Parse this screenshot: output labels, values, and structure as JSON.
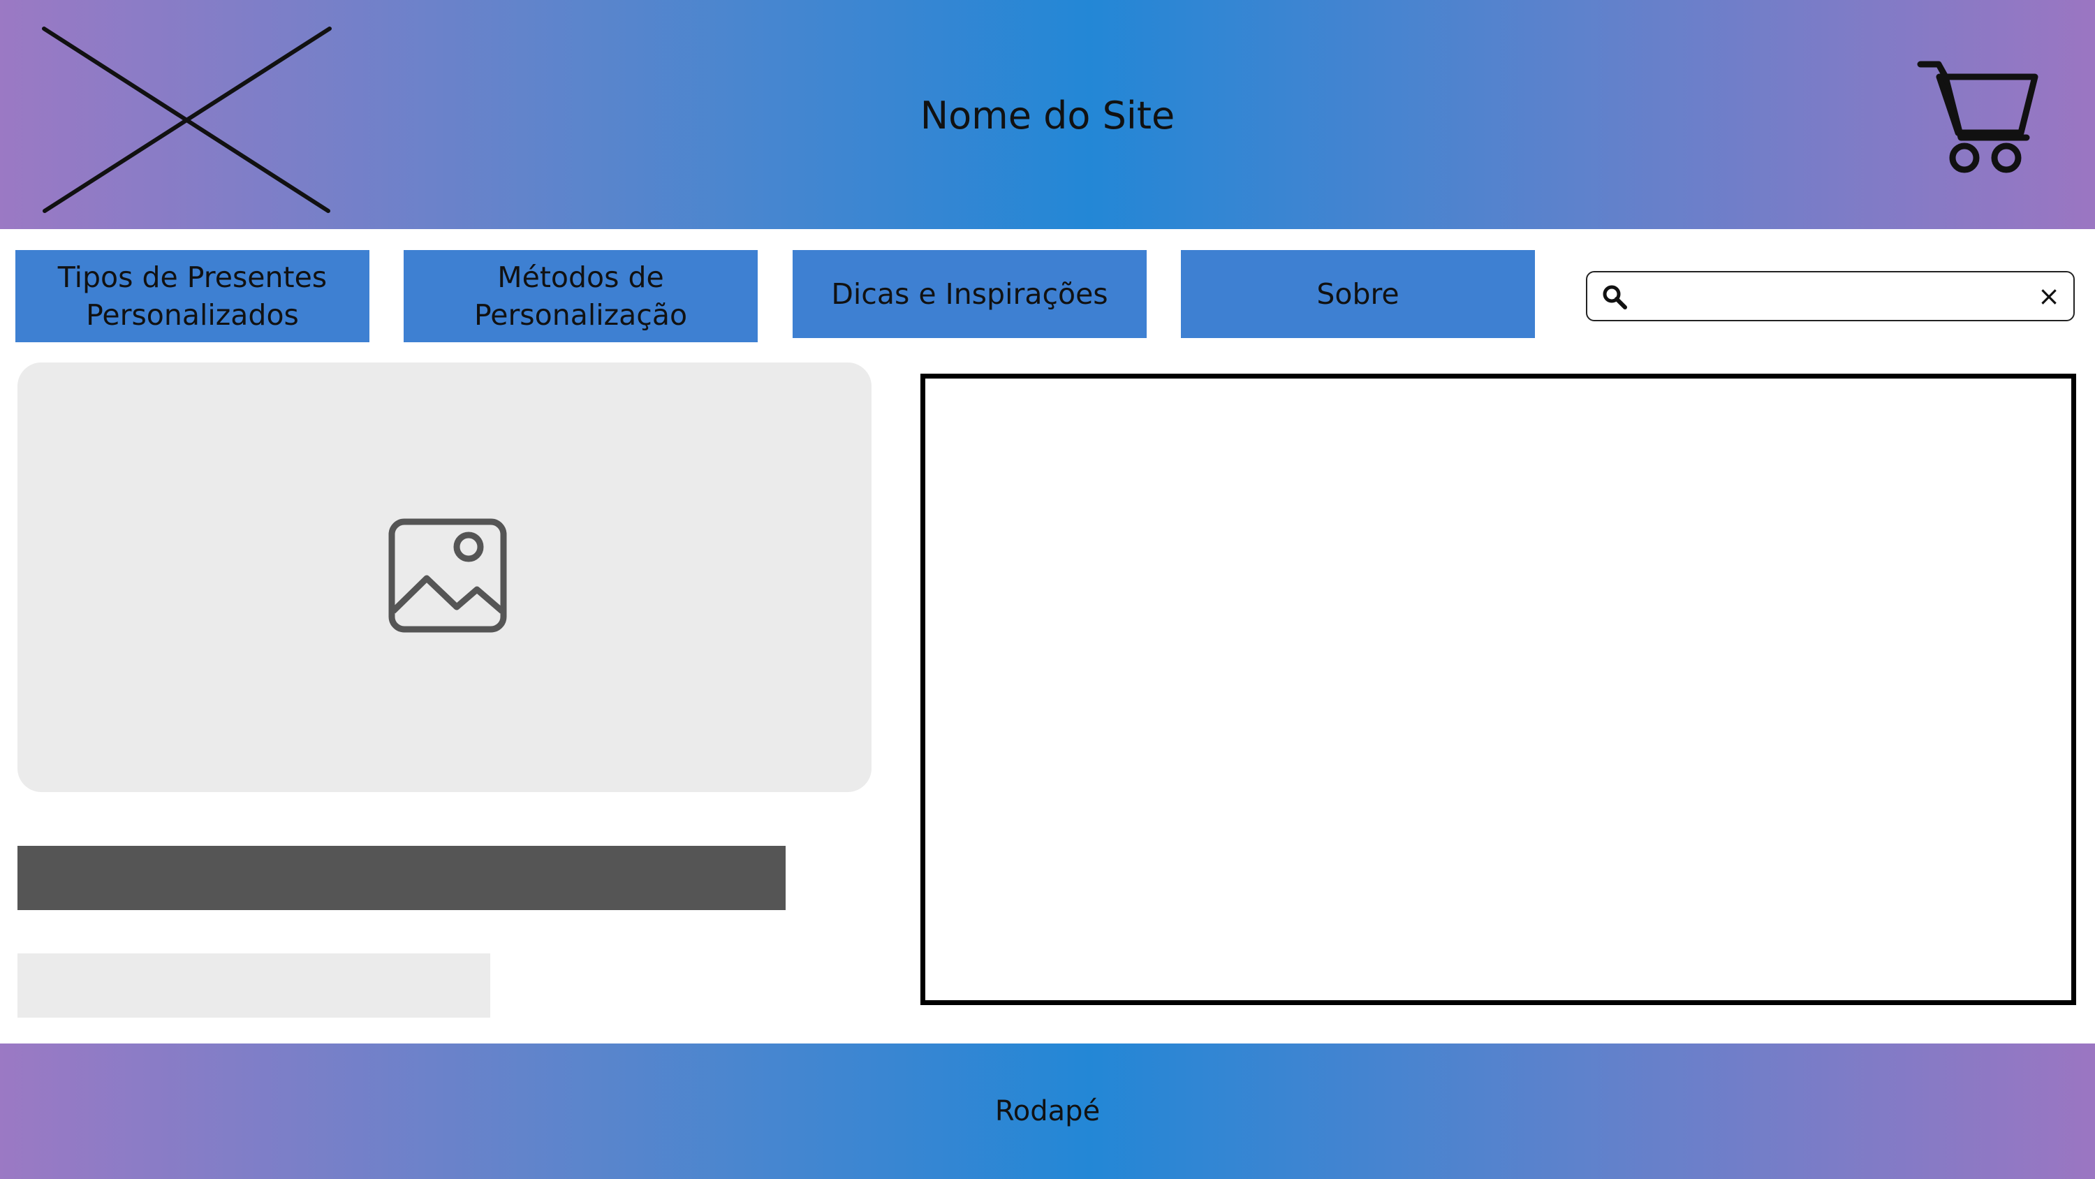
{
  "header": {
    "site_title": "Nome do Site",
    "logo_icon": "image-placeholder-x-icon",
    "cart_icon": "shopping-cart-icon"
  },
  "navigation": {
    "items": [
      {
        "label": "Tipos de Presentes Personalizados"
      },
      {
        "label": "Métodos de Personalização"
      },
      {
        "label": "Dicas e Inspirações"
      },
      {
        "label": "Sobre"
      }
    ]
  },
  "search": {
    "value": "",
    "placeholder": "",
    "search_icon": "search-icon",
    "clear_icon": "close-icon",
    "clear_label": "×"
  },
  "main": {
    "image_icon": "image-icon"
  },
  "footer": {
    "label": "Rodapé"
  },
  "colors": {
    "header_footer_gradient": [
      "#9b79c4",
      "#2387d6",
      "#9b76c2"
    ],
    "nav_button": "#3e80d2",
    "placeholder_light": "#ebebeb",
    "placeholder_dark": "#555555",
    "frame_border": "#000000"
  }
}
